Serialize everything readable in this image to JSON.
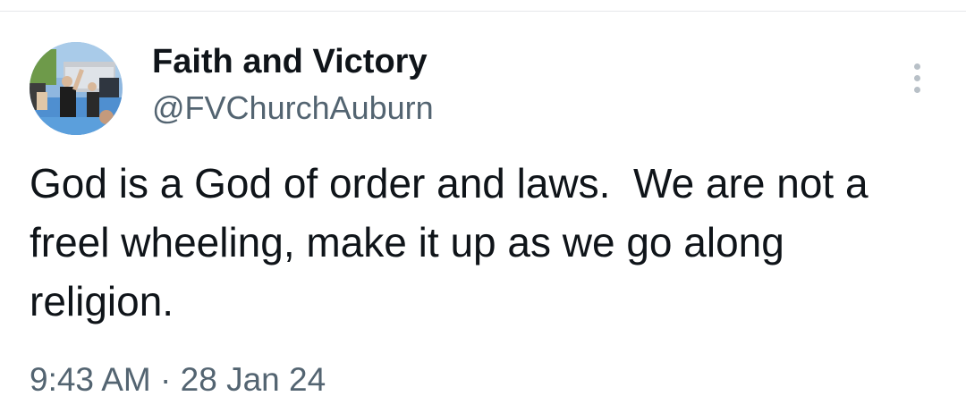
{
  "tweet": {
    "author": {
      "display_name": "Faith and Victory",
      "handle": "@FVChurchAuburn"
    },
    "text": "God is a God of order and laws.  We are not a freel wheeling, make it up as we go along religion.",
    "time": "9:43 AM",
    "separator": "·",
    "date": "28 Jan 24"
  },
  "icons": {
    "more": "more-vertical-icon"
  },
  "colors": {
    "text_primary": "#0f1419",
    "text_secondary": "#536471",
    "icon_muted": "#b8c0c7"
  }
}
